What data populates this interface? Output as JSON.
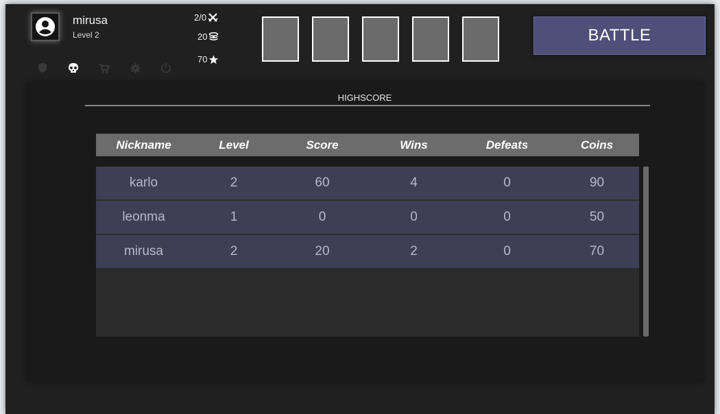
{
  "player": {
    "name": "mirusa",
    "level_label": "Level 2",
    "avatar_icon": "user-circle-icon"
  },
  "stats": {
    "record": "2/0",
    "record_icon": "crossed-swords-icon",
    "score": "20",
    "score_icon": "stack-icon",
    "coins": "70",
    "coins_icon": "star-icon"
  },
  "nav": [
    {
      "name": "shield-icon",
      "active": false
    },
    {
      "name": "skull-icon",
      "active": true
    },
    {
      "name": "cart-icon",
      "active": false
    },
    {
      "name": "gear-icon",
      "active": false
    },
    {
      "name": "power-icon",
      "active": false
    }
  ],
  "slots_count": 5,
  "battle_label": "BATTLE",
  "highscore": {
    "title": "HIGHSCORE",
    "columns": [
      "Nickname",
      "Level",
      "Score",
      "Wins",
      "Defeats",
      "Coins"
    ],
    "rows": [
      [
        "karlo",
        "2",
        "60",
        "4",
        "0",
        "90"
      ],
      [
        "leonma",
        "1",
        "0",
        "0",
        "0",
        "50"
      ],
      [
        "mirusa",
        "2",
        "20",
        "2",
        "0",
        "70"
      ]
    ]
  },
  "colors": {
    "background": "#202020",
    "panel": "#1a1a1a",
    "accent": "#4f4f7a",
    "row": "#3e3e55",
    "header": "#6c6c6c",
    "nav_active": "#ffffff",
    "nav_inactive": "#3a3a3a"
  }
}
